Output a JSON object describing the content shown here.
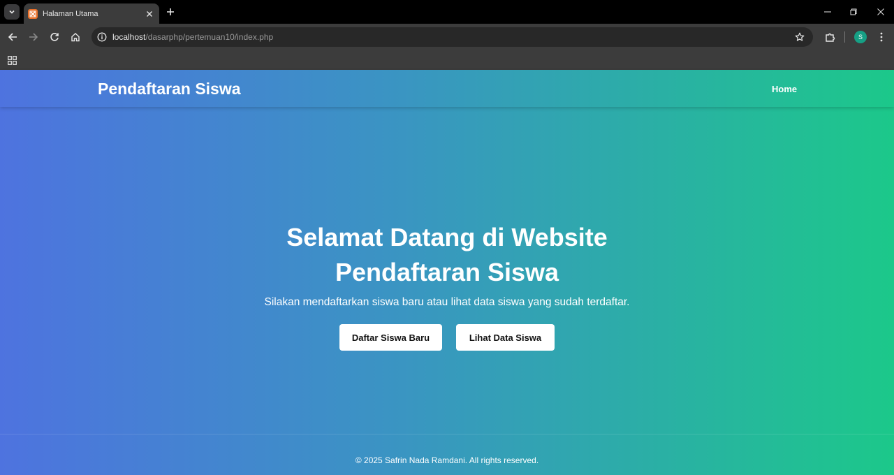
{
  "browser": {
    "tab_title": "Halaman Utama",
    "url_host": "localhost",
    "url_path": "/dasarphp/pertemuan10/index.php",
    "profile_initial": "S",
    "icons": [
      "tab-search-icon",
      "xampp-favicon-icon",
      "close-icon",
      "plus-icon",
      "minimize-icon",
      "restore-icon",
      "back-icon",
      "forward-icon",
      "reload-icon",
      "home-icon",
      "info-icon",
      "star-icon",
      "extensions-icon",
      "kebab-menu-icon",
      "apps-grid-icon"
    ]
  },
  "navbar": {
    "brand": "Pendaftaran Siswa",
    "home_link": "Home"
  },
  "hero": {
    "title_line1": "Selamat Datang di Website",
    "title_line2": "Pendaftaran Siswa",
    "subtitle": "Silakan mendaftarkan siswa baru atau lihat data siswa yang sudah terdaftar.",
    "btn_daftar": "Daftar Siswa Baru",
    "btn_lihat": "Lihat Data Siswa"
  },
  "footer": {
    "text": "© 2025 Safrin Nada Ramdani. All rights reserved."
  },
  "colors": {
    "gradient_start": "#4e73df",
    "gradient_end": "#1cc88a",
    "button_bg": "#ffffff",
    "favicon": "#e8702a",
    "profile": "#16a085"
  }
}
